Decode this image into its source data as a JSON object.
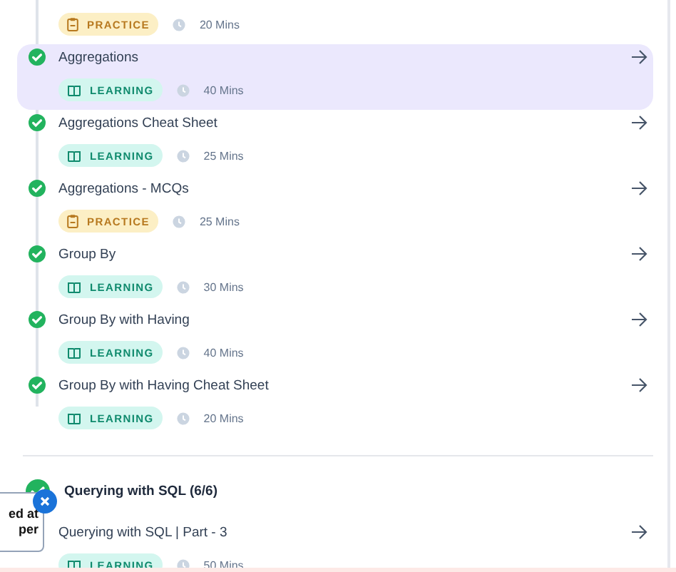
{
  "modules": [
    {
      "kind": "practice",
      "badge": "PRACTICE",
      "duration": "20 Mins",
      "selected": false
    },
    {
      "title": "Aggregations",
      "kind": "learning",
      "badge": "LEARNING",
      "duration": "40 Mins",
      "completed": true,
      "selected": true
    },
    {
      "title": "Aggregations Cheat Sheet",
      "kind": "learning",
      "badge": "LEARNING",
      "duration": "25 Mins",
      "completed": true,
      "selected": false
    },
    {
      "title": "Aggregations - MCQs",
      "kind": "practice",
      "badge": "PRACTICE",
      "duration": "25 Mins",
      "completed": true,
      "selected": false
    },
    {
      "title": "Group By",
      "kind": "learning",
      "badge": "LEARNING",
      "duration": "30 Mins",
      "completed": true,
      "selected": false
    },
    {
      "title": "Group By with Having",
      "kind": "learning",
      "badge": "LEARNING",
      "duration": "40 Mins",
      "completed": true,
      "selected": false
    },
    {
      "title": "Group By with Having Cheat Sheet",
      "kind": "learning",
      "badge": "LEARNING",
      "duration": "20 Mins",
      "completed": true,
      "selected": false
    }
  ],
  "section": {
    "title": "Querying with SQL (6/6)",
    "completed": true,
    "items": [
      {
        "title": "Querying with SQL | Part - 3",
        "kind": "learning",
        "badge": "LEARNING",
        "duration": "50 Mins",
        "selected": false
      }
    ]
  },
  "toast": {
    "lines": [
      "ed at",
      "per"
    ]
  }
}
